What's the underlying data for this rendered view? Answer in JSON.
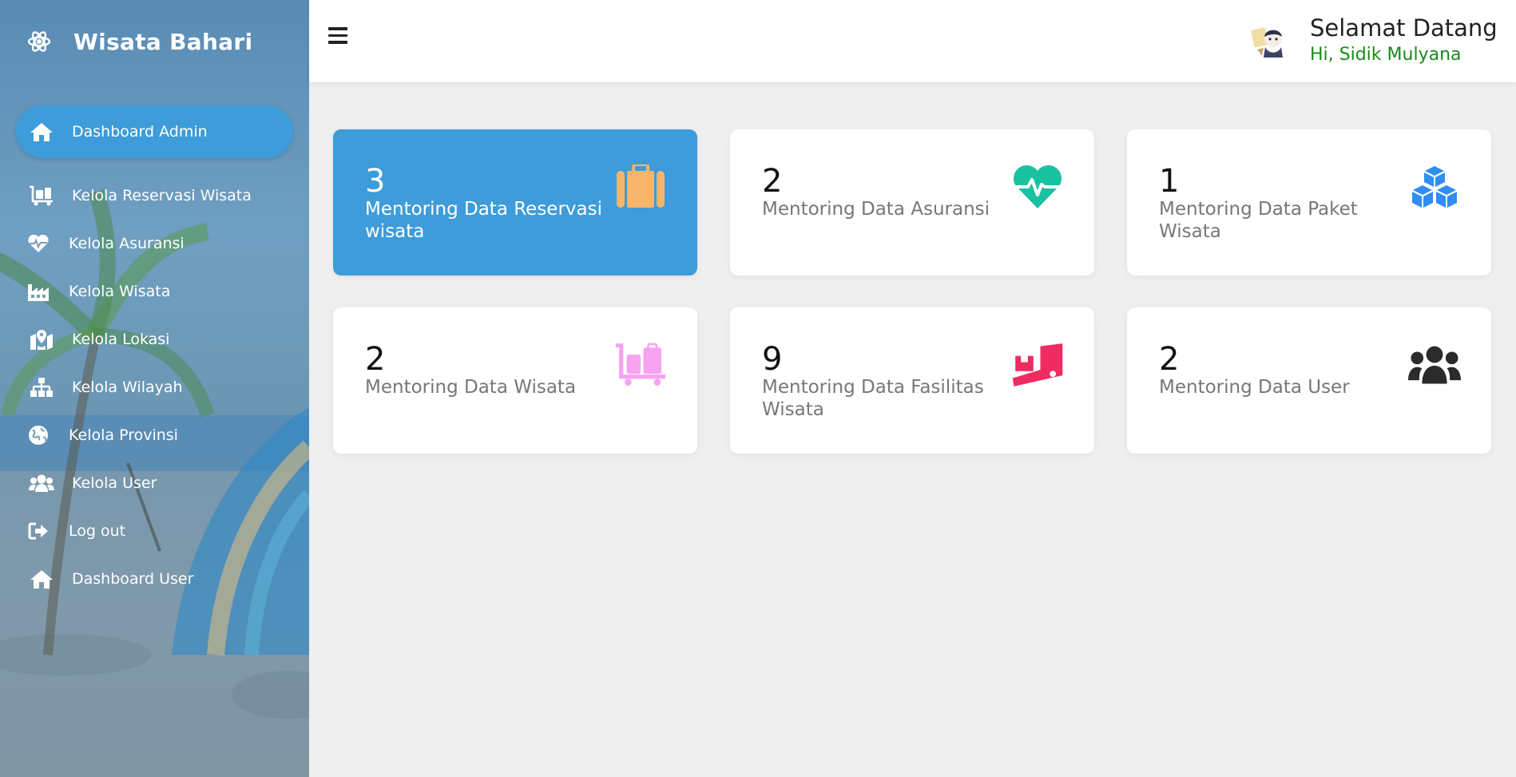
{
  "sidebar": {
    "brand": "Wisata Bahari",
    "items": [
      {
        "label": "Dashboard Admin",
        "icon": "home-icon"
      },
      {
        "label": "Kelola Reservasi Wisata",
        "icon": "luggage-cart-icon"
      },
      {
        "label": "Kelola Asuransi",
        "icon": "heartbeat-icon"
      },
      {
        "label": "Kelola Wisata",
        "icon": "industry-icon"
      },
      {
        "label": "Kelola Lokasi",
        "icon": "map-marked-icon"
      },
      {
        "label": "Kelola Wilayah",
        "icon": "sitemap-icon"
      },
      {
        "label": "Kelola Provinsi",
        "icon": "globe-icon"
      },
      {
        "label": "Kelola User",
        "icon": "users-icon"
      },
      {
        "label": "Log out",
        "icon": "sign-out-icon"
      },
      {
        "label": "Dashboard User",
        "icon": "home-icon"
      }
    ]
  },
  "header": {
    "title": "Selamat Datang",
    "subtitle": "Hi, Sidik Mulyana"
  },
  "cards": [
    {
      "count": "3",
      "label": "Mentoring Data Reservasi wisata",
      "icon": "suitcase-icon",
      "icon_color": "#f7b56b"
    },
    {
      "count": "2",
      "label": "Mentoring Data Asuransi",
      "icon": "heartbeat-icon",
      "icon_color": "#19c2a1"
    },
    {
      "count": "1",
      "label": "Mentoring Data Paket Wisata",
      "icon": "cubes-icon",
      "icon_color": "#2f8ef0"
    },
    {
      "count": "2",
      "label": "Mentoring Data Wisata",
      "icon": "luggage-cart-icon",
      "icon_color": "#f7a3f0"
    },
    {
      "count": "9",
      "label": "Mentoring Data Fasilitas Wisata",
      "icon": "dolly-flatbed-icon",
      "icon_color": "#ef2b62"
    },
    {
      "count": "2",
      "label": "Mentoring Data User",
      "icon": "users-icon",
      "icon_color": "#2b2b2b"
    }
  ],
  "colors": {
    "accent": "#3d9cd9",
    "welcome_sub": "#1a8a1a"
  }
}
